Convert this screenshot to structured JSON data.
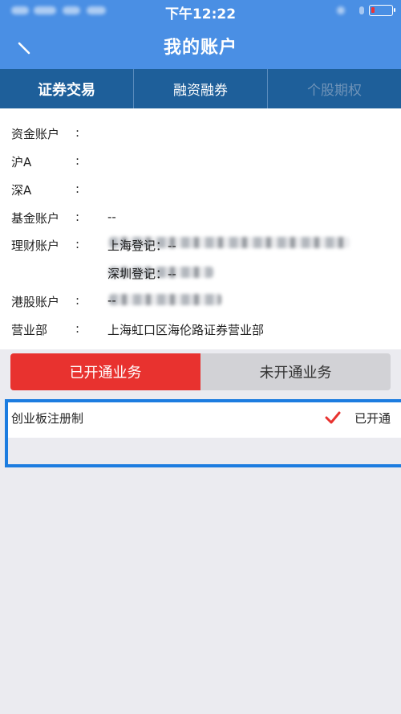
{
  "status_bar": {
    "time": "下午12:22"
  },
  "nav": {
    "title": "我的账户"
  },
  "tabs": [
    {
      "label": "证券交易",
      "active": true
    },
    {
      "label": "融资融券",
      "active": false
    },
    {
      "label": "个股期权",
      "active": false
    }
  ],
  "account": {
    "fund": {
      "label": "资金账户",
      "colon": ":"
    },
    "sh_a": {
      "label": "沪A",
      "colon": ":"
    },
    "sz_a": {
      "label": "深A",
      "colon": ":"
    },
    "fund_account": {
      "label": "基金账户",
      "colon": ":",
      "value": "--"
    },
    "wealth": {
      "label": "理财账户",
      "colon": ":",
      "sh_reg": "上海登记：--",
      "sz_reg": "深圳登记：--"
    },
    "hk": {
      "label": "港股账户",
      "colon": ":",
      "value": "--"
    },
    "branch": {
      "label": "营业部",
      "colon": ":",
      "value": "上海虹口区海伦路证券营业部"
    }
  },
  "segment": {
    "opened": "已开通业务",
    "not_opened": "未开通业务"
  },
  "services": [
    {
      "name": "创业板注册制",
      "status": "已开通"
    }
  ],
  "colors": {
    "nav_blue": "#4a8fe4",
    "tab_dark_blue": "#1e5f9a",
    "accent_red": "#e8322f",
    "highlight_border": "#1c7ce0"
  }
}
